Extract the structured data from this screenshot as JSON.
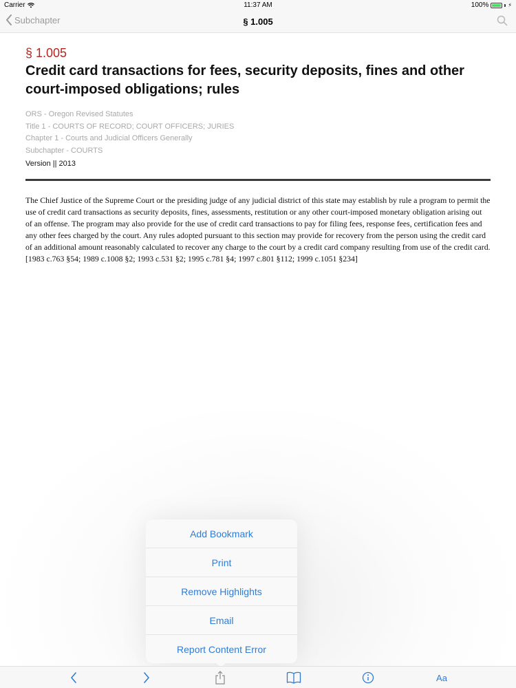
{
  "status_bar": {
    "carrier": "Carrier",
    "time": "11:37 AM",
    "battery_percent": "100%",
    "battery_level": 1.0
  },
  "nav": {
    "back_label": "Subchapter",
    "title": "§ 1.005"
  },
  "document": {
    "section_number": "§ 1.005",
    "title": "Credit card transactions for fees, security deposits, fines and other court-imposed obligations; rules",
    "meta": [
      "ORS - Oregon Revised Statutes",
      "Title 1 - COURTS OF RECORD; COURT OFFICERS; JURIES",
      "Chapter 1 - Courts and Judicial Officers Generally",
      "Subchapter - COURTS"
    ],
    "version": "Version || 2013",
    "body": "The Chief Justice of the Supreme Court or the presiding judge of any judicial district of this state may establish by rule a program to permit the use of credit card transactions as security deposits, fines, assessments, restitution or any other court-imposed monetary obligation arising out of an offense. The program may also provide for the use of credit card transactions to pay for filing fees, response fees, certification fees and any other fees charged by the court. Any rules adopted pursuant to this section may provide for recovery from the person using the credit card of an additional amount reasonably calculated to recover any charge to the court by a credit card company resulting from use of the credit card. [1983 c.763 §54; 1989 c.1008 §2; 1993 c.531 §2; 1995 c.781 §4; 1997 c.801 §112; 1999 c.1051 §234]"
  },
  "share_menu": {
    "items": [
      {
        "label": "Add Bookmark"
      },
      {
        "label": "Print"
      },
      {
        "label": "Remove Highlights"
      },
      {
        "label": "Email"
      },
      {
        "label": "Report Content Error"
      }
    ]
  },
  "toolbar": {
    "font_button_label": "Aa",
    "accent_color": "#2f7cd6",
    "icons": [
      "chevron-left-icon",
      "chevron-right-icon",
      "share-icon",
      "book-icon",
      "info-icon"
    ]
  },
  "colors": {
    "section_number": "#b3261e",
    "accent": "#2f7cd6",
    "meta_text": "#a8a8a8"
  }
}
